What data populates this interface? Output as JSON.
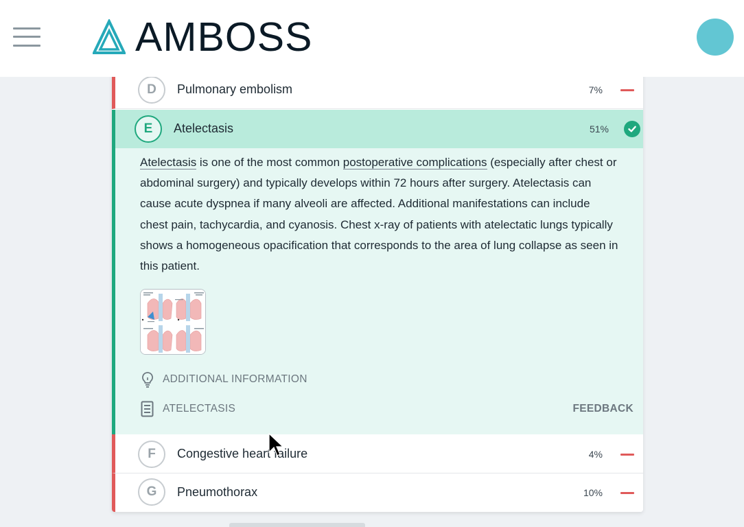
{
  "app": {
    "logo_text": "AMBOSS"
  },
  "colors": {
    "correct": "#1fa87e",
    "incorrect": "#e05a5a",
    "avatar": "#62c6d3",
    "expanded_bg": "#e6f7f3",
    "expanded_head_bg": "#b9ebdc"
  },
  "answers": {
    "d": {
      "letter": "D",
      "label": "Pulmonary embolism",
      "percent": "7%",
      "status": "incorrect"
    },
    "e": {
      "letter": "E",
      "label": "Atelectasis",
      "percent": "51%",
      "status": "correct"
    },
    "f": {
      "letter": "F",
      "label": "Congestive heart failure",
      "percent": "4%",
      "status": "incorrect"
    },
    "g": {
      "letter": "G",
      "label": "Pneumothorax",
      "percent": "10%",
      "status": "incorrect"
    }
  },
  "explanation": {
    "parts": [
      "Atelectasis",
      " is one of the most common ",
      "postoperative complications",
      " (especially after chest or abdominal surgery) and typically develops within 72 hours after surgery. Atelectasis can cause acute dyspnea if many alveoli are affected. Additional manifestations can include chest pain, tachycardia, and cyanosis. Chest x-ray of patients with atelectatic lungs typically shows a homogeneous opacification that corresponds to the area of lung collapse as seen in this patient."
    ]
  },
  "media": {
    "thumbnail_icon": "chest-xray-atelectasis-image"
  },
  "additional_info_label": "ADDITIONAL INFORMATION",
  "article_label": "ATELECTASIS",
  "feedback_label": "FEEDBACK",
  "icons": {
    "menu": "hamburger-menu-icon",
    "additional_info": "lightbulb-icon",
    "article": "document-icon",
    "correct": "checkmark-icon",
    "incorrect": "minus-icon"
  }
}
